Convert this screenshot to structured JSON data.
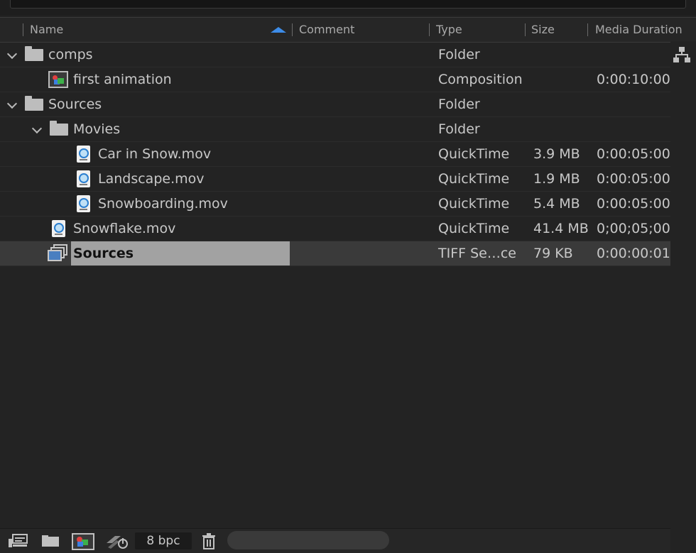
{
  "columns": {
    "name": "Name",
    "comment": "Comment",
    "type": "Type",
    "size": "Size",
    "duration": "Media Duration"
  },
  "rows": [
    {
      "name": "comps",
      "type": "Folder",
      "size": "",
      "duration": "",
      "icon": "folder-icon",
      "expanded": true,
      "depth": 0
    },
    {
      "name": "first animation",
      "type": "Composition",
      "size": "",
      "duration": "0:00:10:00",
      "icon": "composition-icon",
      "depth": 1
    },
    {
      "name": "Sources",
      "type": "Folder",
      "size": "",
      "duration": "",
      "icon": "folder-icon",
      "expanded": true,
      "depth": 0
    },
    {
      "name": "Movies",
      "type": "Folder",
      "size": "",
      "duration": "",
      "icon": "folder-icon",
      "expanded": true,
      "depth": 1
    },
    {
      "name": "Car in Snow.mov",
      "type": "QuickTime",
      "size": "3.9 MB",
      "duration": "0:00:05:00",
      "icon": "quicktime-file-icon",
      "depth": 2
    },
    {
      "name": "Landscape.mov",
      "type": "QuickTime",
      "size": "1.9 MB",
      "duration": "0:00:05:00",
      "icon": "quicktime-file-icon",
      "depth": 2
    },
    {
      "name": "Snowboarding.mov",
      "type": "QuickTime",
      "size": "5.4 MB",
      "duration": "0:00:05:00",
      "icon": "quicktime-file-icon",
      "depth": 2
    },
    {
      "name": "Snowflake.mov",
      "type": "QuickTime",
      "size": "41.4 MB",
      "duration": "0;00;05;00",
      "icon": "quicktime-file-icon",
      "depth": 1
    },
    {
      "name": "Sources",
      "type": "TIFF Se…ce",
      "size": "79 KB",
      "duration": "0:00:00:01",
      "icon": "image-sequence-icon",
      "depth": 1,
      "selected": true
    }
  ],
  "footer": {
    "bit_depth": "8 bpc"
  },
  "colors": {
    "sort_arrow": "#3d8ce8",
    "selection": "#a2a2a2",
    "background": "#232323"
  },
  "icons": [
    "interpret-footage-icon",
    "new-folder-icon",
    "new-composition-icon",
    "project-settings-icon",
    "trash-icon",
    "flowchart-icon",
    "sort-ascending-icon"
  ]
}
